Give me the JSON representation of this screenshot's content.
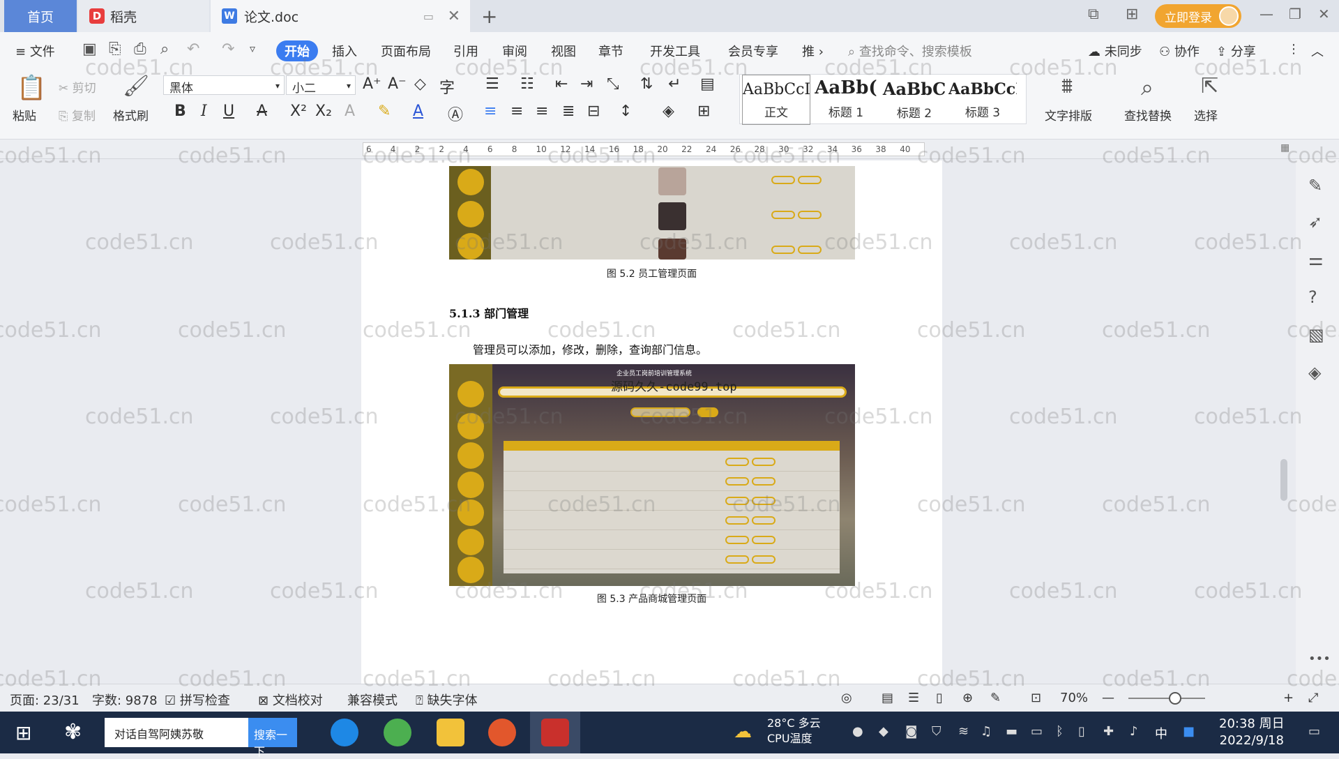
{
  "tabs": {
    "home": "首页",
    "daoke": "稻壳",
    "doc": "论文.doc"
  },
  "titlebar": {
    "login": "立即登录"
  },
  "menu": {
    "file": "文件",
    "start": "开始",
    "insert": "插入",
    "layout": "页面布局",
    "ref": "引用",
    "review": "审阅",
    "view": "视图",
    "chapter": "章节",
    "dev": "开发工具",
    "vip": "会员专享",
    "more": "推",
    "search_cmd": "查找命令、搜索模板",
    "sync": "未同步",
    "collab": "协作",
    "share": "分享"
  },
  "ribbon": {
    "paste": "粘贴",
    "cut": "剪切",
    "copy": "复制",
    "format_painter": "格式刷",
    "font": "黑体",
    "size": "小二",
    "text_layout": "文字排版",
    "find_replace": "查找替换",
    "select": "选择",
    "styles": [
      {
        "preview": "AaBbCcI",
        "name": "正文"
      },
      {
        "preview": "AaBb(",
        "name": "标题 1"
      },
      {
        "preview": "AaBbC",
        "name": "标题 2"
      },
      {
        "preview": "AaBbCcI",
        "name": "标题 3"
      }
    ]
  },
  "ruler": {
    "ticks": [
      "6",
      "4",
      "2",
      "2",
      "4",
      "6",
      "8",
      "10",
      "12",
      "14",
      "16",
      "18",
      "20",
      "22",
      "24",
      "26",
      "28",
      "30",
      "32",
      "34",
      "36",
      "38",
      "40"
    ]
  },
  "document": {
    "fig52_caption": "图 5.2  员工管理页面",
    "section": "5.1.3  部门管理",
    "paragraph": "管理员可以添加，修改，删除，查询部门信息。",
    "fig53_header": "企业员工岗前培训管理系统",
    "fig53_overlay": "源码久久-code99.top",
    "fig53_caption": "图 5.3  产品商城管理页面"
  },
  "watermark": "code51.cn",
  "status": {
    "page": "页面: 23/31",
    "words": "字数: 9878",
    "spell": "拼写检查",
    "proof": "文档校对",
    "compat": "兼容模式",
    "missing_font": "缺失字体",
    "zoom": "70%"
  },
  "taskbar": {
    "search_text": "对话自驾阿姨苏敬",
    "search_btn": "搜索一下",
    "weather_temp": "28°C 多云",
    "weather_sub": "CPU温度",
    "ime": "中",
    "time": "20:38 周日",
    "date": "2022/9/18"
  }
}
